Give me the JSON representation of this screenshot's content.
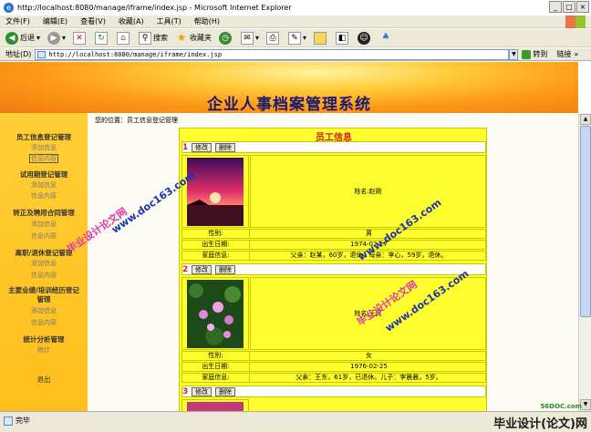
{
  "window": {
    "title": "http://localhost:8080/manage/iframe/index.jsp - Microsoft Internet Explorer",
    "controls": [
      "_",
      "□",
      "×"
    ]
  },
  "menu": [
    "文件(F)",
    "编辑(E)",
    "查看(V)",
    "收藏(A)",
    "工具(T)",
    "帮助(H)"
  ],
  "toolbar": {
    "back": "后退",
    "search": "搜索",
    "favorites": "收藏夹"
  },
  "address": {
    "label": "地址(D)",
    "url": "http://localhost:8080/manage/iframe/index.jsp",
    "go": "转到",
    "links": "链接"
  },
  "banner": {
    "title": "企业人事档案管理系统"
  },
  "sidebar": {
    "groups": [
      {
        "label": "员工信息登记管理",
        "items": [
          "添加信息",
          "信息内容"
        ]
      },
      {
        "label": "试用期登记管理",
        "items": [
          "添加信息",
          "信息内容"
        ]
      },
      {
        "label": "转正及聘用合同管理",
        "items": [
          "添加信息",
          "信息内容"
        ]
      },
      {
        "label": "离职/退休登记管理",
        "items": [
          "添加信息",
          "信息内容"
        ]
      },
      {
        "label": "主要业绩/培训经历登记管理",
        "items": [
          "添加信息",
          "信息内容"
        ]
      },
      {
        "label": "统计分析管理",
        "items": [
          "统计"
        ]
      }
    ],
    "logout": "退出"
  },
  "breadcrumb": "您的位置：员工信息登记管理",
  "card": {
    "title": "员工信息",
    "edit_label": "修改",
    "delete_label": "删除",
    "field_labels": {
      "gender": "性别:",
      "birth": "出生日期:",
      "family": "家庭信息:"
    },
    "records": [
      {
        "num": "1",
        "name": "姓名:赵刚",
        "gender": "男",
        "birth": "1974-02-27",
        "family": "父亲：赵某，60岁，退休。母亲：李心，59岁，退休。"
      },
      {
        "num": "2",
        "name": "姓名:王民",
        "gender": "女",
        "birth": "1976-02-25",
        "family": "父亲：王东，61岁，已退休。儿子：李晨晨，5岁。"
      },
      {
        "num": "3"
      }
    ]
  },
  "watermarks": [
    "毕业设计论文网",
    "www.doc163.com"
  ],
  "status": {
    "text": "完毕",
    "site": "56DOC.com",
    "brand": "毕业设计(论文)网"
  }
}
